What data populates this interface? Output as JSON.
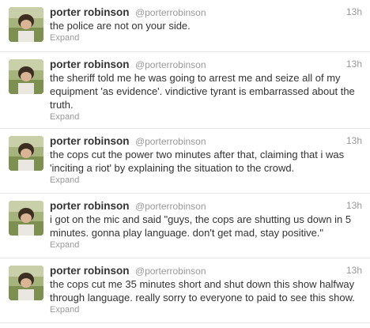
{
  "tweets": [
    {
      "fullname": "porter robinson",
      "username": "@porterrobinson",
      "time": "13h",
      "text": "the police are not on your side.",
      "expand": "Expand"
    },
    {
      "fullname": "porter robinson",
      "username": "@porterrobinson",
      "time": "13h",
      "text": "the sheriff told me he was going to arrest me and seize all of my equipment 'as evidence'. vindictive tyrant is embarrassed about the truth.",
      "expand": "Expand"
    },
    {
      "fullname": "porter robinson",
      "username": "@porterrobinson",
      "time": "13h",
      "text": "the cops cut the power two minutes after that, claiming that i was 'inciting a riot' by explaining the situation to the crowd.",
      "expand": "Expand"
    },
    {
      "fullname": "porter robinson",
      "username": "@porterrobinson",
      "time": "13h",
      "text": "i got on the mic and said \"guys, the cops are shutting us down in 5 minutes. gonna play language. don't get mad, stay positive.\"",
      "expand": "Expand"
    },
    {
      "fullname": "porter robinson",
      "username": "@porterrobinson",
      "time": "13h",
      "text": "the cops cut me 35 minutes short and shut down this show halfway through language. really sorry to everyone to paid to see this show.",
      "expand": "Expand"
    }
  ]
}
